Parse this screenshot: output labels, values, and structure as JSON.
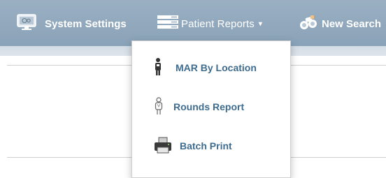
{
  "navbar": {
    "items": [
      {
        "label": "System Settings",
        "icon": "monitor-settings-icon"
      },
      {
        "label": "Patient Reports",
        "icon": "report-list-icon",
        "caret": "▾"
      },
      {
        "label": "New Search",
        "icon": "binoculars-icon"
      }
    ]
  },
  "dropdown": {
    "items": [
      {
        "label": "MAR By Location",
        "icon": "person-location-icon"
      },
      {
        "label": "Rounds Report",
        "icon": "person-outline-icon"
      },
      {
        "label": "Batch Print",
        "icon": "printer-icon"
      }
    ]
  },
  "colors": {
    "navbar_bg": "#8ea6bb",
    "menu_text": "#3f6c8e",
    "nav_text": "#ffffff"
  }
}
